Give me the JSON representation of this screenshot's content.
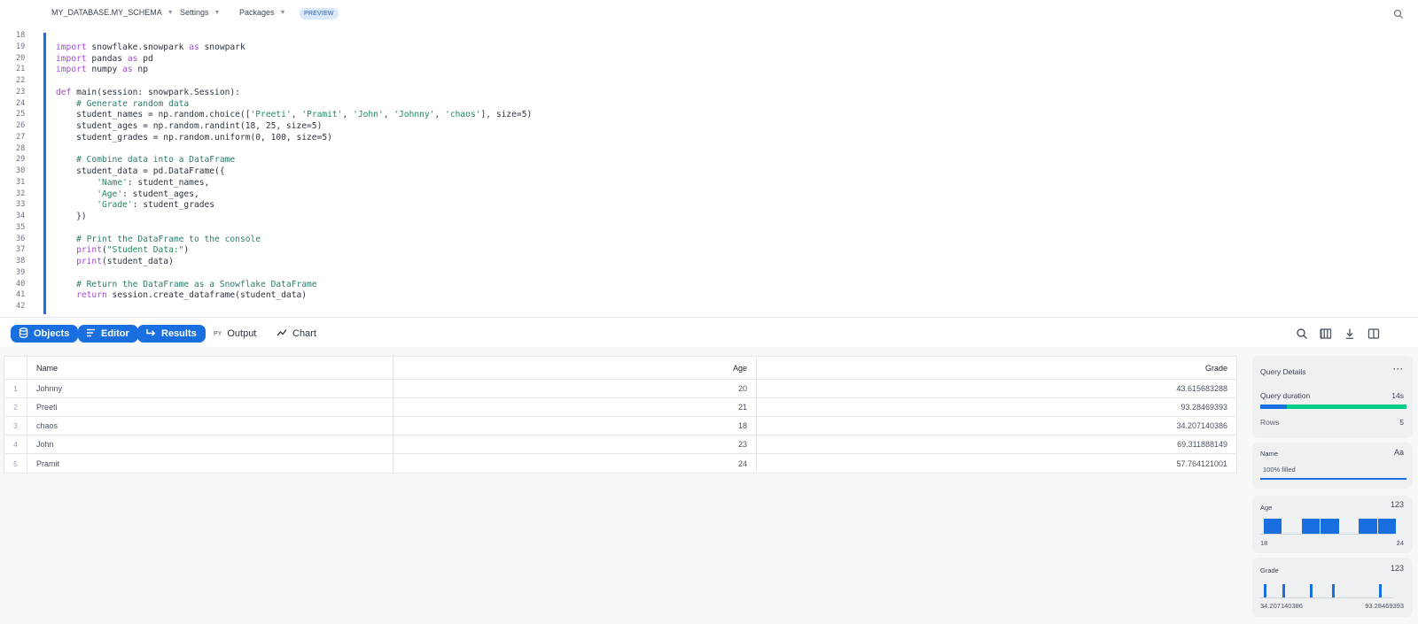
{
  "topbar": {
    "database": "MY_DATABASE.MY_SCHEMA",
    "settings": "Settings",
    "packages": "Packages",
    "preview_badge": "PREVIEW",
    "caret": "▼"
  },
  "editor": {
    "lines": [
      {
        "n": "18",
        "parts": []
      },
      {
        "n": "19",
        "parts": [
          {
            "t": "import",
            "c": "kw"
          },
          {
            "t": " snowflake.snowpark "
          },
          {
            "t": "as",
            "c": "kw"
          },
          {
            "t": " snowpark"
          }
        ]
      },
      {
        "n": "20",
        "parts": [
          {
            "t": "import",
            "c": "kw"
          },
          {
            "t": " pandas "
          },
          {
            "t": "as",
            "c": "kw"
          },
          {
            "t": " pd"
          }
        ]
      },
      {
        "n": "21",
        "parts": [
          {
            "t": "import",
            "c": "kw"
          },
          {
            "t": " numpy "
          },
          {
            "t": "as",
            "c": "kw"
          },
          {
            "t": " np"
          }
        ]
      },
      {
        "n": "22",
        "parts": []
      },
      {
        "n": "23",
        "parts": [
          {
            "t": "def",
            "c": "kw"
          },
          {
            "t": " main(session: snowpark.Session):"
          }
        ]
      },
      {
        "n": "24",
        "parts": [
          {
            "t": "    "
          },
          {
            "t": "# Generate random data",
            "c": "cm"
          }
        ]
      },
      {
        "n": "25",
        "parts": [
          {
            "t": "    student_names = np.random.choice(["
          },
          {
            "t": "'Preeti'",
            "c": "str"
          },
          {
            "t": ", "
          },
          {
            "t": "'Pramit'",
            "c": "str"
          },
          {
            "t": ", "
          },
          {
            "t": "'John'",
            "c": "str"
          },
          {
            "t": ", "
          },
          {
            "t": "'Johnny'",
            "c": "str"
          },
          {
            "t": ", "
          },
          {
            "t": "'chaos'",
            "c": "str"
          },
          {
            "t": "], size=5)"
          }
        ]
      },
      {
        "n": "26",
        "parts": [
          {
            "t": "    student_ages = np.random.randint(18, 25, size=5)"
          }
        ]
      },
      {
        "n": "27",
        "parts": [
          {
            "t": "    student_grades = np.random.uniform(0, 100, size=5)"
          }
        ]
      },
      {
        "n": "28",
        "parts": []
      },
      {
        "n": "29",
        "parts": [
          {
            "t": "    "
          },
          {
            "t": "# Combine data into a DataFrame",
            "c": "cm"
          }
        ]
      },
      {
        "n": "30",
        "parts": [
          {
            "t": "    student_data = pd.DataFrame({"
          }
        ]
      },
      {
        "n": "31",
        "parts": [
          {
            "t": "        "
          },
          {
            "t": "'Name'",
            "c": "str"
          },
          {
            "t": ": student_names,"
          }
        ]
      },
      {
        "n": "32",
        "parts": [
          {
            "t": "        "
          },
          {
            "t": "'Age'",
            "c": "str"
          },
          {
            "t": ": student_ages,"
          }
        ]
      },
      {
        "n": "33",
        "parts": [
          {
            "t": "        "
          },
          {
            "t": "'Grade'",
            "c": "str"
          },
          {
            "t": ": student_grades"
          }
        ]
      },
      {
        "n": "34",
        "parts": [
          {
            "t": "    })"
          }
        ]
      },
      {
        "n": "35",
        "parts": []
      },
      {
        "n": "36",
        "parts": [
          {
            "t": "    "
          },
          {
            "t": "# Print the DataFrame to the console",
            "c": "cm"
          }
        ]
      },
      {
        "n": "37",
        "parts": [
          {
            "t": "    "
          },
          {
            "t": "print",
            "c": "kw"
          },
          {
            "t": "("
          },
          {
            "t": "\"Student Data:\"",
            "c": "str"
          },
          {
            "t": ")"
          }
        ]
      },
      {
        "n": "38",
        "parts": [
          {
            "t": "    "
          },
          {
            "t": "print",
            "c": "kw"
          },
          {
            "t": "(student_data)"
          }
        ]
      },
      {
        "n": "39",
        "parts": []
      },
      {
        "n": "40",
        "parts": [
          {
            "t": "    "
          },
          {
            "t": "# Return the DataFrame as a Snowflake DataFrame",
            "c": "cm"
          }
        ]
      },
      {
        "n": "41",
        "parts": [
          {
            "t": "    "
          },
          {
            "t": "return",
            "c": "kw"
          },
          {
            "t": " session.create_dataframe(student_data)"
          }
        ]
      },
      {
        "n": "42",
        "parts": []
      }
    ]
  },
  "toolbar": {
    "objects": "Objects",
    "editor": "Editor",
    "results": "Results",
    "output_prefix": "PY",
    "output": "Output",
    "chart": "Chart",
    "icons": [
      "search-icon",
      "columns-icon",
      "download-icon",
      "split-panel-icon"
    ]
  },
  "table": {
    "columns": [
      "Name",
      "Age",
      "Grade"
    ],
    "rows": [
      {
        "idx": "1",
        "name": "Johnny",
        "age": "20",
        "grade": "43.615683288"
      },
      {
        "idx": "2",
        "name": "Preeti",
        "age": "21",
        "grade": "93.28469393"
      },
      {
        "idx": "3",
        "name": "chaos",
        "age": "18",
        "grade": "34.207140386"
      },
      {
        "idx": "4",
        "name": "John",
        "age": "23",
        "grade": "69.311888149"
      },
      {
        "idx": "5",
        "name": "Pramit",
        "age": "24",
        "grade": "57.764121001"
      }
    ]
  },
  "query_details": {
    "title": "Query Details",
    "more": "···",
    "duration_label": "Query duration",
    "duration_value": "14s",
    "duration_split_fraction": 0.18,
    "rows_label": "Rows",
    "rows_value": "5"
  },
  "name_card": {
    "title": "Name",
    "type": "Aa",
    "filled_text": "100% filled",
    "filled_fraction": 1.0
  },
  "age_card": {
    "title": "Age",
    "type": "123",
    "min": "18",
    "max": "24",
    "histogram": [
      1,
      0,
      1,
      1,
      0,
      1,
      1
    ]
  },
  "grade_card": {
    "title": "Grade",
    "type": "123",
    "min": "34.207140386",
    "max": "93.28469393",
    "values": [
      34.207140386,
      43.615683288,
      57.764121001,
      69.311888149,
      93.28469393
    ]
  },
  "colors": {
    "accent": "#1a6fe0",
    "success": "#00cc88"
  }
}
